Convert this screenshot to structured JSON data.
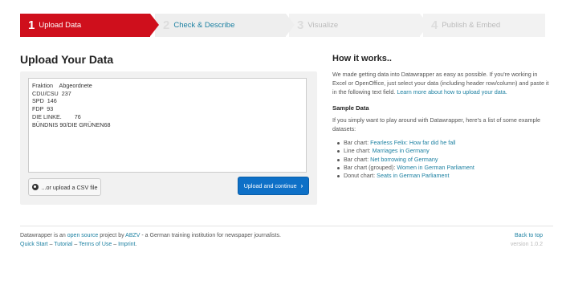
{
  "steps": [
    {
      "number": "1",
      "label": "Upload Data"
    },
    {
      "number": "2",
      "label": "Check & Describe"
    },
    {
      "number": "3",
      "label": "Visualize"
    },
    {
      "number": "4",
      "label": "Publish & Embed"
    }
  ],
  "upload": {
    "title": "Upload Your Data",
    "data_text": "Fraktion    Abgeordnete\nCDU/CSU  237\nSPD  146\nFDP  93\nDIE LINKE.        76\nBÜNDNIS 90/DIE GRÜNEN68",
    "csv_button": "...or upload a CSV file",
    "upload_button": "Upload and continue",
    "upload_button_icon": "chevron-right-icon"
  },
  "howto": {
    "title": "How it works..",
    "intro": "We made getting data into Datawrapper as easy as possible. If you're working in Excel or OpenOffice, just select your data (including header row/column) and paste it in the following text field. ",
    "intro_link": "Learn more about how to upload your data.",
    "sample_title": "Sample Data",
    "sample_intro": "If you simply want to play around with Datawrapper, here's a list of some example datasets:",
    "samples": [
      {
        "type": "Bar chart:",
        "name": "Fearless Felix: How far did he fall"
      },
      {
        "type": "Line chart:",
        "name": "Marriages in Germany"
      },
      {
        "type": "Bar chart:",
        "name": "Net borrowing of Germany"
      },
      {
        "type": "Bar chart (grouped):",
        "name": "Women in German Parliament"
      },
      {
        "type": "Donut chart:",
        "name": "Seats in German Parliament"
      }
    ]
  },
  "footer": {
    "text1": "Datawrapper is an ",
    "link1": "open source",
    "text2": " project by ",
    "link2": "ABZV",
    "text3": " - a German training institution for newspaper journalists.",
    "links": [
      "Quick Start",
      "Tutorial",
      "Terms of Use",
      "Imprint"
    ],
    "separator": " – ",
    "back_to_top": "Back to top",
    "version": "version 1.0.2"
  },
  "colors": {
    "active_step": "#cf0f1c",
    "primary_button": "#0e70c7",
    "link": "#1d81a2"
  }
}
